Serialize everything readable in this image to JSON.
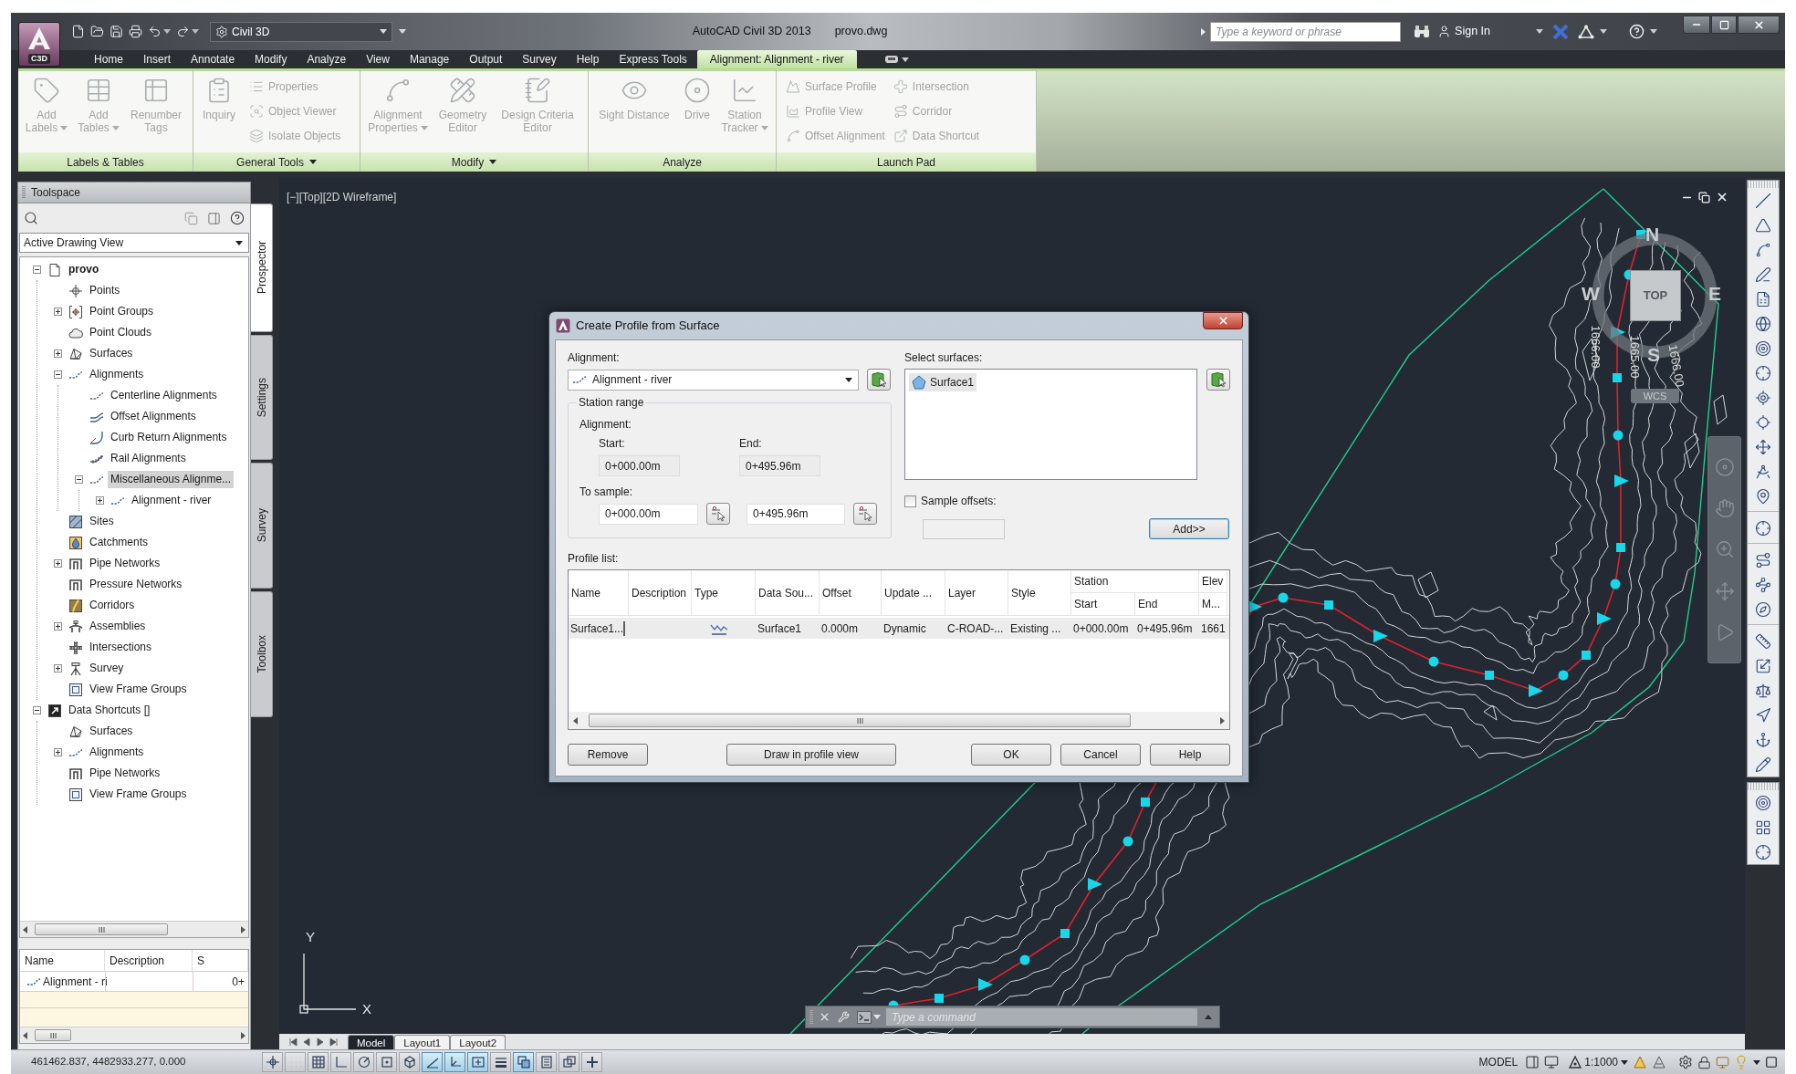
{
  "app_button": {
    "badge": "C3D"
  },
  "quick_access": {
    "workspace": "Civil 3D"
  },
  "window": {
    "title": "AutoCAD Civil 3D 2013",
    "file_name": "provo.dwg"
  },
  "search": {
    "placeholder": "Type a keyword or phrase"
  },
  "sign_in": "Sign In",
  "ribbon_tabs": [
    {
      "label": "Home",
      "selected": false
    },
    {
      "label": "Insert",
      "selected": false
    },
    {
      "label": "Annotate",
      "selected": false
    },
    {
      "label": "Modify",
      "selected": false
    },
    {
      "label": "Analyze",
      "selected": false
    },
    {
      "label": "View",
      "selected": false
    },
    {
      "label": "Manage",
      "selected": false
    },
    {
      "label": "Output",
      "selected": false
    },
    {
      "label": "Survey",
      "selected": false
    },
    {
      "label": "Help",
      "selected": false
    },
    {
      "label": "Express Tools",
      "selected": false
    },
    {
      "label": "Alignment: Alignment - river",
      "selected": true
    }
  ],
  "ribbon_panels": [
    {
      "title": "Labels & Tables",
      "menu": false,
      "buttons": [
        {
          "label": "Add Labels",
          "kind": "large",
          "menu": true,
          "disabled": true
        },
        {
          "label": "Add Tables",
          "kind": "large",
          "menu": true,
          "disabled": true
        },
        {
          "label": "Renumber Tags",
          "kind": "large",
          "menu": false,
          "disabled": true
        }
      ]
    },
    {
      "title": "General Tools",
      "menu": true,
      "buttons": [
        {
          "label": "Inquiry",
          "kind": "large",
          "menu": false,
          "disabled": true
        },
        {
          "label": "Properties",
          "kind": "small",
          "menu": false,
          "disabled": true
        },
        {
          "label": "Object Viewer",
          "kind": "small",
          "menu": false,
          "disabled": true
        },
        {
          "label": "Isolate Objects",
          "kind": "small",
          "menu": false,
          "disabled": true
        }
      ]
    },
    {
      "title": "Modify",
      "menu": true,
      "buttons": [
        {
          "label": "Alignment Properties",
          "kind": "large",
          "menu": true,
          "disabled": true
        },
        {
          "label": "Geometry Editor",
          "kind": "large",
          "menu": false,
          "disabled": true
        },
        {
          "label": "Design Criteria Editor",
          "kind": "large",
          "menu": false,
          "disabled": true
        }
      ]
    },
    {
      "title": "Analyze",
      "menu": false,
      "buttons": [
        {
          "label": "Sight Distance",
          "kind": "large",
          "menu": false,
          "disabled": true
        },
        {
          "label": "Drive",
          "kind": "large",
          "menu": false,
          "disabled": true
        },
        {
          "label": "Station Tracker",
          "kind": "large",
          "menu": true,
          "disabled": true
        }
      ]
    },
    {
      "title": "Launch Pad",
      "menu": false,
      "buttons": [
        {
          "label": "Surface Profile",
          "kind": "small",
          "menu": false,
          "disabled": true
        },
        {
          "label": "Profile View",
          "kind": "small",
          "menu": false,
          "disabled": true
        },
        {
          "label": "Offset Alignment",
          "kind": "small",
          "menu": false,
          "disabled": true
        },
        {
          "label": "Intersection",
          "kind": "small",
          "menu": false,
          "disabled": true
        },
        {
          "label": "Corridor",
          "kind": "small",
          "menu": false,
          "disabled": true
        },
        {
          "label": "Data Shortcut",
          "kind": "small",
          "menu": false,
          "disabled": true
        }
      ]
    }
  ],
  "toolspace": {
    "title": "Toolspace",
    "view_selector": "Active Drawing View",
    "tree": [
      {
        "label": "provo",
        "kind": "drawing",
        "selected": false,
        "expanded": true,
        "children": [
          {
            "label": "Points",
            "kind": "points",
            "selected": false
          },
          {
            "label": "Point Groups",
            "kind": "pointgroups",
            "selected": false,
            "expanded": false
          },
          {
            "label": "Point Clouds",
            "kind": "pointclouds",
            "selected": false
          },
          {
            "label": "Surfaces",
            "kind": "surfaces",
            "selected": false,
            "expanded": false
          },
          {
            "label": "Alignments",
            "kind": "alignments",
            "selected": false,
            "expanded": true,
            "children": [
              {
                "label": "Centerline Alignments",
                "kind": "centerline",
                "selected": false
              },
              {
                "label": "Offset Alignments",
                "kind": "offset",
                "selected": false
              },
              {
                "label": "Curb Return Alignments",
                "kind": "curbreturn",
                "selected": false
              },
              {
                "label": "Rail Alignments",
                "kind": "rail",
                "selected": false
              },
              {
                "label": "Miscellaneous Alignme...",
                "kind": "misc",
                "selected": true,
                "expanded": true,
                "children": [
                  {
                    "label": "Alignment - river",
                    "kind": "alignment",
                    "selected": false,
                    "expanded": false
                  }
                ]
              }
            ]
          },
          {
            "label": "Sites",
            "kind": "sites",
            "selected": false
          },
          {
            "label": "Catchments",
            "kind": "catchments",
            "selected": false
          },
          {
            "label": "Pipe Networks",
            "kind": "pipes",
            "selected": false,
            "expanded": false
          },
          {
            "label": "Pressure Networks",
            "kind": "pressure",
            "selected": false
          },
          {
            "label": "Corridors",
            "kind": "corridors",
            "selected": false
          },
          {
            "label": "Assemblies",
            "kind": "assemblies",
            "selected": false,
            "expanded": false
          },
          {
            "label": "Intersections",
            "kind": "intersections",
            "selected": false
          },
          {
            "label": "Survey",
            "kind": "survey",
            "selected": false,
            "expanded": false
          },
          {
            "label": "View Frame Groups",
            "kind": "viewframes",
            "selected": false
          }
        ]
      },
      {
        "label": "Data Shortcuts []",
        "kind": "shortcuts",
        "selected": false,
        "expanded": true,
        "children": [
          {
            "label": "Surfaces",
            "kind": "surfaces",
            "selected": false
          },
          {
            "label": "Alignments",
            "kind": "alignments",
            "selected": false,
            "expanded": false
          },
          {
            "label": "Pipe Networks",
            "kind": "pipes",
            "selected": false
          },
          {
            "label": "View Frame Groups",
            "kind": "viewframes",
            "selected": false
          }
        ]
      }
    ],
    "side_tabs": [
      {
        "label": "Prospector",
        "selected": true
      },
      {
        "label": "Settings",
        "selected": false
      },
      {
        "label": "Survey",
        "selected": false
      },
      {
        "label": "Toolbox",
        "selected": false
      }
    ],
    "list": {
      "columns": [
        "Name",
        "Description",
        "S"
      ],
      "rows": [
        {
          "name": "Alignment - ri",
          "column_3": "0+"
        }
      ]
    }
  },
  "viewport": {
    "controls": [
      "[−]",
      "[Top]",
      "[2D Wireframe]"
    ]
  },
  "view_cube": {
    "top": "TOP",
    "north": "N",
    "south": "S",
    "east": "E",
    "west": "W",
    "ucs": "WCS"
  },
  "contour_labels": [
    "1666.00",
    "1665.00",
    "1666.00"
  ],
  "ucs_icon": {
    "x": "X",
    "y": "Y"
  },
  "command_line": {
    "placeholder": "Type a command"
  },
  "dialog": {
    "title": "Create Profile from Surface",
    "alignment_label": "Alignment:",
    "alignment_value": "Alignment - river",
    "station_range": {
      "title": "Station range",
      "subtitle": "Alignment:",
      "start_label": "Start:",
      "start": "0+000.00m",
      "end_label": "End:",
      "end": "0+495.96m",
      "sample_label": "To sample:",
      "sample_start": "0+000.00m",
      "sample_end": "0+495.96m"
    },
    "surfaces_label": "Select surfaces:",
    "surfaces": [
      {
        "label": "Surface1",
        "selected": true
      }
    ],
    "sample_offsets": {
      "label": "Sample offsets:",
      "checked": false
    },
    "offset_field": {
      "disabled": true
    },
    "add_button": {
      "label": "Add>>",
      "focused": true
    },
    "profile_list_label": "Profile list:",
    "columns": [
      {
        "label": "Name"
      },
      {
        "label": "Description"
      },
      {
        "label": "Type"
      },
      {
        "label": "Data Sou..."
      },
      {
        "label": "Offset"
      },
      {
        "label": "Update ..."
      },
      {
        "label": "Layer"
      },
      {
        "label": "Style"
      },
      {
        "label": "Station",
        "sub": [
          "Start",
          "End"
        ]
      },
      {
        "label": "Elev",
        "sub": [
          "M..."
        ]
      }
    ],
    "rows": [
      {
        "selected": true,
        "editing": true,
        "cells": [
          {
            "kind": "text",
            "text": "Surface1..."
          },
          {
            "kind": "blank"
          },
          {
            "kind": "icon"
          },
          {
            "kind": "text",
            "text": "Surface1"
          },
          {
            "kind": "text",
            "text": "0.000m"
          },
          {
            "kind": "text",
            "text": "Dynamic"
          },
          {
            "kind": "text",
            "text": "C-ROAD-..."
          },
          {
            "kind": "text",
            "text": "Existing ..."
          },
          {
            "kind": "group",
            "cells": [
              {
                "kind": "text",
                "text": "0+000.00m"
              },
              {
                "kind": "text",
                "text": "0+495.96m"
              }
            ]
          },
          {
            "kind": "group",
            "cells": [
              {
                "kind": "text",
                "text": "1661"
              }
            ]
          }
        ]
      }
    ],
    "buttons": [
      "Remove",
      "Draw in profile view",
      "OK",
      "Cancel",
      "Help"
    ]
  },
  "layout_tabs": [
    {
      "label": "Model",
      "selected": true
    },
    {
      "label": "Layout1",
      "selected": false
    },
    {
      "label": "Layout2",
      "selected": false
    }
  ],
  "status_bar": {
    "coordinates": "461462.837, 4482933.277, 0.000",
    "toggles": [
      {
        "kind": "infer",
        "on": false
      },
      {
        "kind": "snap",
        "on": false
      },
      {
        "kind": "grid",
        "on": false
      },
      {
        "kind": "ortho",
        "on": false
      },
      {
        "kind": "polar",
        "on": false
      },
      {
        "kind": "osnap",
        "on": false
      },
      {
        "kind": "osnap3d",
        "on": false
      },
      {
        "kind": "otrack",
        "on": true
      },
      {
        "kind": "ducs",
        "on": true
      },
      {
        "kind": "dyn",
        "on": true
      },
      {
        "kind": "lwt",
        "on": false
      },
      {
        "kind": "tpy",
        "on": true
      },
      {
        "kind": "qp",
        "on": false
      },
      {
        "kind": "sc",
        "on": false
      },
      {
        "kind": "am",
        "on": false
      }
    ],
    "space": "MODEL",
    "annotation_scale": "1:1000"
  }
}
